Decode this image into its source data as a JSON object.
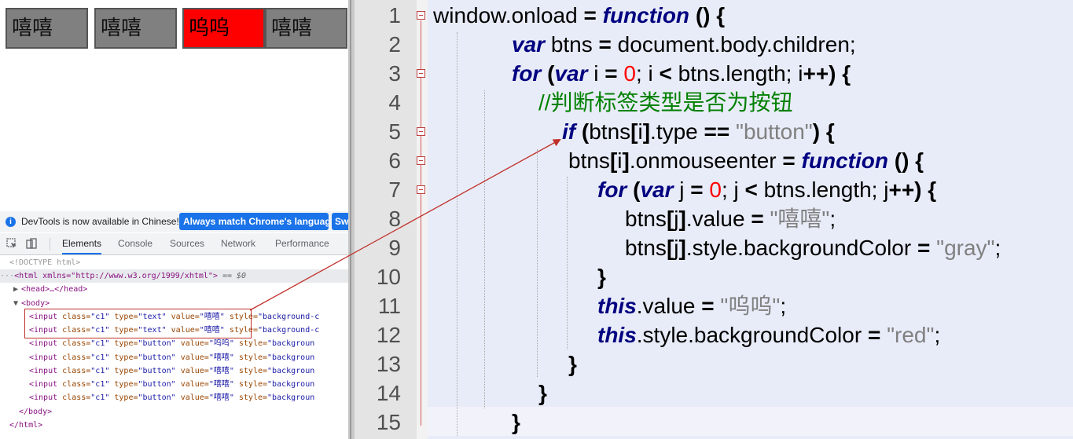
{
  "page_buttons": [
    "嘻嘻",
    "嘻嘻",
    "呜呜",
    "嘻嘻"
  ],
  "infobar": {
    "icon": "i",
    "text": "DevTools is now available in Chinese!",
    "match_btn": "Always match Chrome's language",
    "switch_btn": "Sw"
  },
  "devtools_tabs": [
    "Elements",
    "Console",
    "Sources",
    "Network",
    "Performance"
  ],
  "dom": {
    "doctype": "<!DOCTYPE html>",
    "html_open": "<html xmlns=\"http://www.w3.org/1999/xhtml\">",
    "html_suffix": " == $0",
    "head": "<head>…</head>",
    "body_open": "<body>",
    "inputs": [
      {
        "open": "<input ",
        "class_attr": "class=",
        "class_val": "\"c1\"",
        "type_attr": " type=",
        "type_val": "\"text\"",
        "value_attr": " value=",
        "value_val": "\"嘻嘻\"",
        "style_attr": " style=",
        "style_val": "\"background-c"
      },
      {
        "open": "<input ",
        "class_attr": "class=",
        "class_val": "\"c1\"",
        "type_attr": " type=",
        "type_val": "\"text\"",
        "value_attr": " value=",
        "value_val": "\"嘻嘻\"",
        "style_attr": " style=",
        "style_val": "\"background-c"
      },
      {
        "open": "<input ",
        "class_attr": "class=",
        "class_val": "\"c1\"",
        "type_attr": " type=",
        "type_val": "\"button\"",
        "value_attr": " value=",
        "value_val": "\"呜呜\"",
        "style_attr": " style=",
        "style_val": "\"backgroun"
      },
      {
        "open": "<input ",
        "class_attr": "class=",
        "class_val": "\"c1\"",
        "type_attr": " type=",
        "type_val": "\"button\"",
        "value_attr": " value=",
        "value_val": "\"嘻嘻\"",
        "style_attr": " style=",
        "style_val": "\"backgroun"
      },
      {
        "open": "<input ",
        "class_attr": "class=",
        "class_val": "\"c1\"",
        "type_attr": " type=",
        "type_val": "\"button\"",
        "value_attr": " value=",
        "value_val": "\"嘻嘻\"",
        "style_attr": " style=",
        "style_val": "\"backgroun"
      },
      {
        "open": "<input ",
        "class_attr": "class=",
        "class_val": "\"c1\"",
        "type_attr": " type=",
        "type_val": "\"button\"",
        "value_attr": " value=",
        "value_val": "\"嘻嘻\"",
        "style_attr": " style=",
        "style_val": "\"backgroun"
      },
      {
        "open": "<input ",
        "class_attr": "class=",
        "class_val": "\"c1\"",
        "type_attr": " type=",
        "type_val": "\"button\"",
        "value_attr": " value=",
        "value_val": "\"嘻嘻\"",
        "style_attr": " style=",
        "style_val": "\"backgroun"
      }
    ],
    "body_close": "</body>",
    "html_close": "</html>"
  },
  "editor": {
    "line_numbers": [
      "1",
      "2",
      "3",
      "4",
      "5",
      "6",
      "7",
      "8",
      "9",
      "10",
      "11",
      "12",
      "13",
      "14",
      "15"
    ],
    "lines": [
      [
        [
          "t",
          "window.onload "
        ],
        [
          "op",
          "="
        ],
        [
          "t",
          " "
        ],
        [
          "kw",
          "function"
        ],
        [
          "t",
          " "
        ],
        [
          "op",
          "() {"
        ]
      ],
      [
        [
          "kw",
          "var"
        ],
        [
          "t",
          " btns "
        ],
        [
          "op",
          "="
        ],
        [
          "t",
          " document.body.children;"
        ]
      ],
      [
        [
          "kw",
          "for"
        ],
        [
          "t",
          " "
        ],
        [
          "op",
          "("
        ],
        [
          "kw",
          "var"
        ],
        [
          "t",
          " i "
        ],
        [
          "op",
          "="
        ],
        [
          "t",
          " "
        ],
        [
          "num",
          "0"
        ],
        [
          "t",
          "; i "
        ],
        [
          "op",
          "<"
        ],
        [
          "t",
          " btns.length; i"
        ],
        [
          "op",
          "++) {"
        ]
      ],
      [
        [
          "cm",
          "//判断标签类型是否为按钮"
        ]
      ],
      [
        [
          "kw",
          "if"
        ],
        [
          "t",
          " "
        ],
        [
          "op",
          "("
        ],
        [
          "t",
          "btns"
        ],
        [
          "op",
          "["
        ],
        [
          "t",
          "i"
        ],
        [
          "op",
          "]"
        ],
        [
          "t",
          ".type "
        ],
        [
          "op",
          "=="
        ],
        [
          "t",
          " "
        ],
        [
          "str",
          "\"button\""
        ],
        [
          "op",
          ") {"
        ]
      ],
      [
        [
          "t",
          "btns"
        ],
        [
          "op",
          "["
        ],
        [
          "t",
          "i"
        ],
        [
          "op",
          "]"
        ],
        [
          "t",
          ".onmouseenter "
        ],
        [
          "op",
          "="
        ],
        [
          "t",
          " "
        ],
        [
          "kw",
          "function"
        ],
        [
          "t",
          " "
        ],
        [
          "op",
          "() {"
        ]
      ],
      [
        [
          "kw",
          "for"
        ],
        [
          "t",
          " "
        ],
        [
          "op",
          "("
        ],
        [
          "kw",
          "var"
        ],
        [
          "t",
          " j "
        ],
        [
          "op",
          "="
        ],
        [
          "t",
          " "
        ],
        [
          "num",
          "0"
        ],
        [
          "t",
          "; j "
        ],
        [
          "op",
          "<"
        ],
        [
          "t",
          " btns.length; j"
        ],
        [
          "op",
          "++) {"
        ]
      ],
      [
        [
          "t",
          "btns"
        ],
        [
          "op",
          "["
        ],
        [
          "t",
          "j"
        ],
        [
          "op",
          "]"
        ],
        [
          "t",
          ".value "
        ],
        [
          "op",
          "="
        ],
        [
          "t",
          " "
        ],
        [
          "str",
          "\"嘻嘻\""
        ],
        [
          "t",
          ";"
        ]
      ],
      [
        [
          "t",
          "btns"
        ],
        [
          "op",
          "["
        ],
        [
          "t",
          "j"
        ],
        [
          "op",
          "]"
        ],
        [
          "t",
          ".style.backgroundColor "
        ],
        [
          "op",
          "="
        ],
        [
          "t",
          " "
        ],
        [
          "str",
          "\"gray\""
        ],
        [
          "t",
          ";"
        ]
      ],
      [
        [
          "op",
          "}"
        ]
      ],
      [
        [
          "kw",
          "this"
        ],
        [
          "t",
          ".value "
        ],
        [
          "op",
          "="
        ],
        [
          "t",
          " "
        ],
        [
          "str",
          "\"呜呜\""
        ],
        [
          "t",
          ";"
        ]
      ],
      [
        [
          "kw",
          "this"
        ],
        [
          "t",
          ".style.backgroundColor "
        ],
        [
          "op",
          "="
        ],
        [
          "t",
          " "
        ],
        [
          "str",
          "\"red\""
        ],
        [
          "t",
          ";"
        ]
      ],
      [
        [
          "op",
          "}"
        ]
      ],
      [
        [
          "op",
          "}"
        ]
      ],
      [
        [
          "op",
          "}"
        ]
      ]
    ]
  },
  "colors": {
    "keyword": "#000080",
    "number": "#ff0000",
    "string": "#808080",
    "comment": "#008000",
    "annotation": "#c0302a",
    "active_button": "#ff0000",
    "normal_button": "#808080"
  }
}
